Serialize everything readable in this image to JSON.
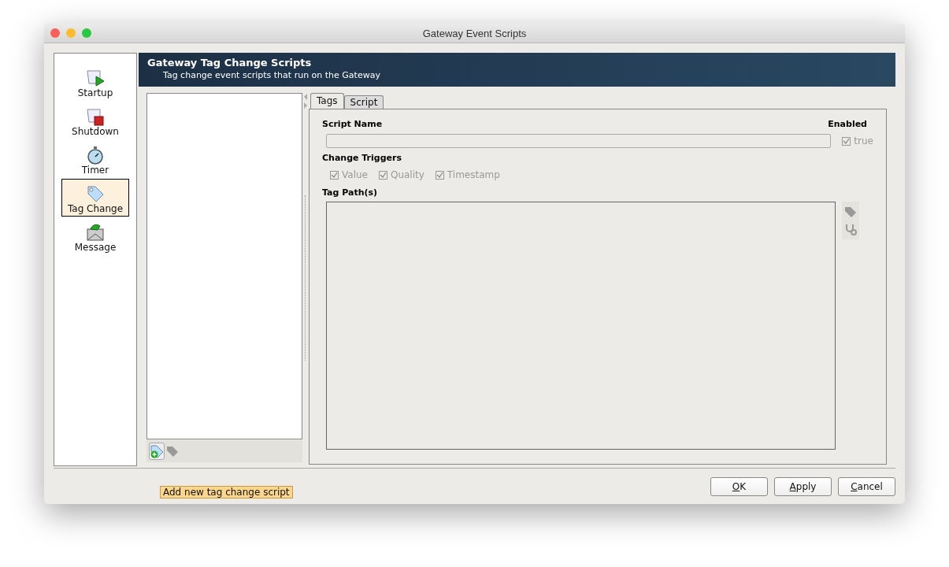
{
  "window": {
    "title": "Gateway Event Scripts"
  },
  "sidebar": {
    "items": [
      {
        "label": "Startup",
        "kind": "startup",
        "selected": false
      },
      {
        "label": "Shutdown",
        "kind": "shutdown",
        "selected": false
      },
      {
        "label": "Timer",
        "kind": "timer",
        "selected": false
      },
      {
        "label": "Tag Change",
        "kind": "tag",
        "selected": true
      },
      {
        "label": "Message",
        "kind": "message",
        "selected": false
      }
    ]
  },
  "header": {
    "title": "Gateway Tag Change Scripts",
    "subtitle": "Tag change event scripts that run on the Gateway"
  },
  "tabs": [
    {
      "label": "Tags",
      "selected": true
    },
    {
      "label": "Script",
      "selected": false
    }
  ],
  "form": {
    "script_name_label": "Script Name",
    "enabled_label": "Enabled",
    "enabled": {
      "label": "true",
      "checked": true,
      "disabled": true
    },
    "triggers_label": "Change Triggers",
    "triggers": [
      {
        "label": "Value",
        "checked": true,
        "disabled": true
      },
      {
        "label": "Quality",
        "checked": true,
        "disabled": true
      },
      {
        "label": "Timestamp",
        "checked": true,
        "disabled": true
      }
    ],
    "tag_paths_label": "Tag Path(s)"
  },
  "tooltip": "Add new tag change script",
  "buttons": [
    "OK",
    "Apply",
    "Cancel"
  ]
}
